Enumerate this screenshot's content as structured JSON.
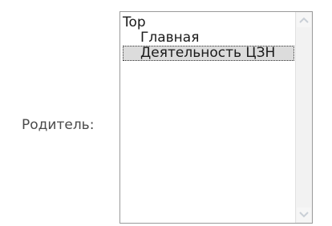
{
  "form": {
    "parent_label": "Родитель:"
  },
  "listbox": {
    "items": [
      {
        "label": "Top",
        "level": 0,
        "selected": false
      },
      {
        "label": "Главная",
        "level": 1,
        "selected": false
      },
      {
        "label": "Деятельность ЦЗН",
        "level": 1,
        "selected": true
      }
    ]
  },
  "icons": {
    "scroll_up": "chevron-up-icon",
    "scroll_down": "chevron-down-icon"
  },
  "colors": {
    "selection_bg": "#dcdcdc",
    "border": "#9a9a9a",
    "label_text": "#4a4a4a"
  }
}
